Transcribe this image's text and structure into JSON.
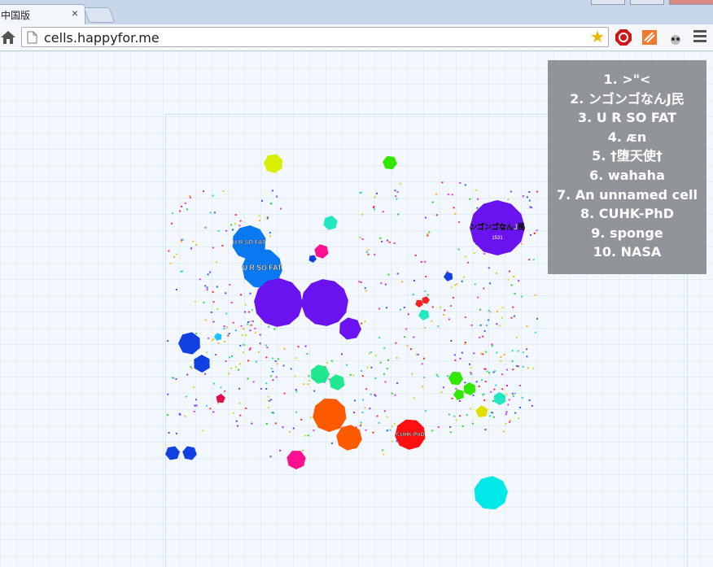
{
  "browser": {
    "tab_title": "中国版",
    "tab_close": "×",
    "url": "cells.happyfor.me"
  },
  "colors": {
    "accent_star": "#f0b400",
    "leaderboard_bg": "#7b7f83"
  },
  "icons": {
    "home": "home-icon",
    "page": "page-icon",
    "star": "star-icon",
    "menu": "menu-icon"
  },
  "leaderboard": {
    "entries": [
      {
        "rank": "1.",
        "name": ">\"<"
      },
      {
        "rank": "2.",
        "name": "ンゴンゴなんJ民"
      },
      {
        "rank": "3.",
        "name": "U R SO FAT"
      },
      {
        "rank": "4.",
        "name": "ᴁn"
      },
      {
        "rank": "5.",
        "name": "†堕天使†"
      },
      {
        "rank": "6.",
        "name": "wahaha"
      },
      {
        "rank": "7.",
        "name": "An unnamed cell"
      },
      {
        "rank": "8.",
        "name": "CUHK-PhD"
      },
      {
        "rank": "9.",
        "name": "sponge"
      },
      {
        "rank": "10.",
        "name": "NASA"
      }
    ]
  },
  "cells": [
    {
      "name": "ンゴンゴなんJ民",
      "mass": "1531",
      "color": "#6a12f0"
    },
    {
      "name": "U R SO FAT",
      "mass": "",
      "color": "#0a78f0"
    },
    {
      "name": "U R SO FAT",
      "mass": "",
      "color": "#0a78f0"
    },
    {
      "name": "",
      "mass": "",
      "color": "#6a12f0"
    },
    {
      "name": "",
      "mass": "",
      "color": "#6a12f0"
    },
    {
      "name": "",
      "mass": "",
      "color": "#6a12f0"
    },
    {
      "name": "",
      "mass": "",
      "color": "#1040e0"
    },
    {
      "name": "",
      "mass": "",
      "color": "#1040e0"
    },
    {
      "name": "",
      "mass": "",
      "color": "#1040e0"
    },
    {
      "name": "",
      "mass": "",
      "color": "#1040e0"
    },
    {
      "name": "",
      "mass": "",
      "color": "#ff5a00"
    },
    {
      "name": "",
      "mass": "",
      "color": "#ff5a00"
    },
    {
      "name": "CUHK-PhD",
      "mass": "",
      "color": "#ff1010"
    },
    {
      "name": "",
      "mass": "",
      "color": "#00e8e8"
    },
    {
      "name": "",
      "mass": "",
      "color": "#ff1090"
    },
    {
      "name": "",
      "mass": "",
      "color": "#ff1090"
    },
    {
      "name": "",
      "mass": "",
      "color": "#d8f000"
    },
    {
      "name": "",
      "mass": "",
      "color": "#20e890"
    },
    {
      "name": "",
      "mass": "",
      "color": "#20e890"
    },
    {
      "name": "",
      "mass": "",
      "color": "#20e8c0"
    },
    {
      "name": "",
      "mass": "",
      "color": "#30e800"
    },
    {
      "name": "",
      "mass": "",
      "color": "#30e800"
    },
    {
      "name": "",
      "mass": "",
      "color": "#30e800"
    },
    {
      "name": "",
      "mass": "",
      "color": "#30e800"
    },
    {
      "name": "",
      "mass": "",
      "color": "#20e8c0"
    },
    {
      "name": "",
      "mass": "",
      "color": "#20e8c0"
    },
    {
      "name": "",
      "mass": "",
      "color": "#e0e000"
    },
    {
      "name": "",
      "mass": "",
      "color": "#ff2020"
    },
    {
      "name": "",
      "mass": "",
      "color": "#ff2020"
    },
    {
      "name": "",
      "mass": "",
      "color": "#20c0ff"
    },
    {
      "name": "",
      "mass": "",
      "color": "#e01050"
    },
    {
      "name": "",
      "mass": "",
      "color": "#1040e0"
    },
    {
      "name": "",
      "mass": "",
      "color": "#1040e0"
    }
  ]
}
